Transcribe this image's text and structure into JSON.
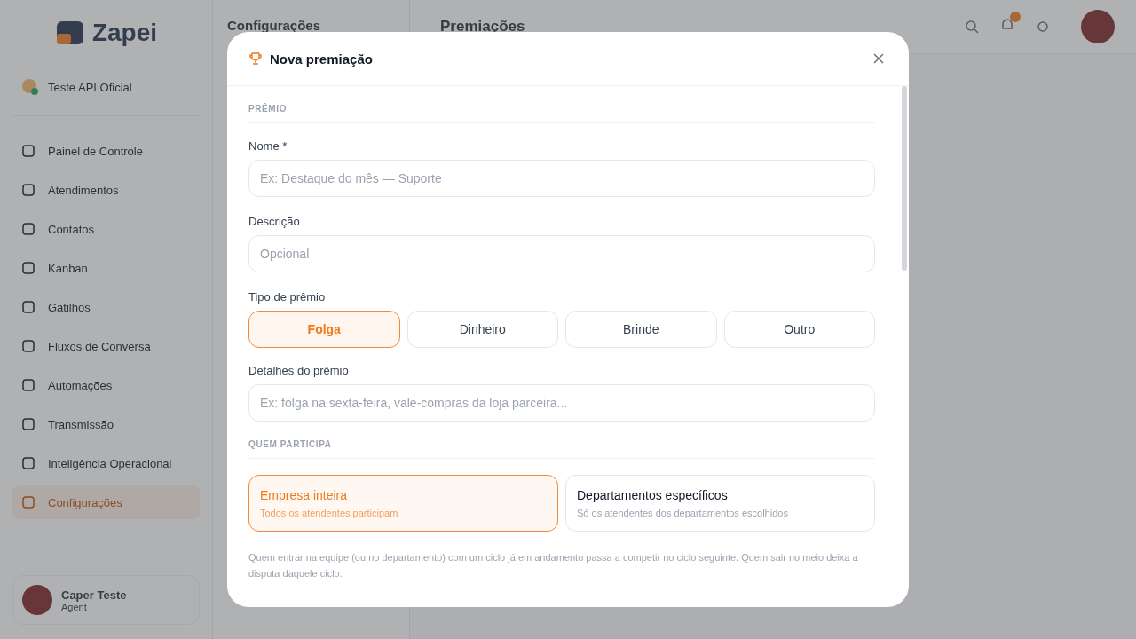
{
  "background": {
    "sidebar": {
      "brand": "Zapei",
      "account": "Teste API Oficial",
      "items": [
        {
          "label": "Painel de Controle",
          "selected": false
        },
        {
          "label": "Atendimentos",
          "selected": false
        },
        {
          "label": "Contatos",
          "selected": false
        },
        {
          "label": "Kanban",
          "selected": false
        },
        {
          "label": "Gatilhos",
          "selected": false
        },
        {
          "label": "Fluxos de Conversa",
          "selected": false
        },
        {
          "label": "Automações",
          "selected": false
        },
        {
          "label": "Transmissão",
          "selected": false
        },
        {
          "label": "Inteligência Operacional",
          "selected": false
        },
        {
          "label": "Configurações",
          "selected": true
        }
      ],
      "user": {
        "name": "Caper Teste",
        "role": "Agent"
      }
    },
    "subnav": {
      "title": "Configurações"
    },
    "main": {
      "title": "Premiações"
    }
  },
  "modal": {
    "title": "Nova premiação",
    "prize_section": "PRÊMIO",
    "name_field": {
      "label": "Nome *",
      "placeholder": "Ex: Destaque do mês — Suporte"
    },
    "description_field": {
      "label": "Descrição",
      "placeholder": "Opcional"
    },
    "prize_type": {
      "label": "Tipo de prêmio",
      "options": [
        {
          "label": "Folga",
          "selected": true
        },
        {
          "label": "Dinheiro",
          "selected": false
        },
        {
          "label": "Brinde",
          "selected": false
        },
        {
          "label": "Outro",
          "selected": false
        }
      ]
    },
    "details_field": {
      "label": "Detalhes do prêmio",
      "placeholder": "Ex: folga na sexta-feira, vale-compras da loja parceira..."
    },
    "participants_section": "QUEM PARTICIPA",
    "scope_options": [
      {
        "title": "Empresa inteira",
        "subtitle": "Todos os atendentes participam",
        "selected": true
      },
      {
        "title": "Departamentos específicos",
        "subtitle": "Só os atendentes dos departamentos escolhidos",
        "selected": false
      }
    ],
    "note": "Quem entrar na equipe (ou no departamento) com um ciclo já em andamento passa a competir no ciclo seguinte. Quem sair no meio deixa a disputa daquele ciclo."
  }
}
